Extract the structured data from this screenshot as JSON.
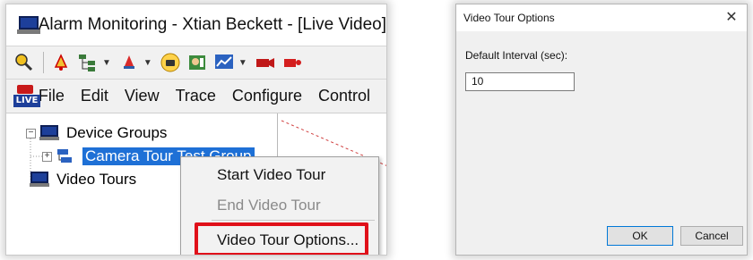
{
  "left_window": {
    "title": "Alarm Monitoring - Xtian Beckett - [Live Video]",
    "live_badge": "LIVE",
    "menu": {
      "file": "File",
      "edit": "Edit",
      "view": "View",
      "trace": "Trace",
      "configure": "Configure",
      "control": "Control"
    },
    "tree": {
      "device_groups": "Device Groups",
      "camera_tour_test_group": "Camera Tour Test Group",
      "video_tours": "Video Tours"
    },
    "context_menu": {
      "start_video_tour": "Start Video Tour",
      "end_video_tour": "End Video Tour",
      "video_tour_options": "Video Tour Options..."
    },
    "highlight_color": "#e0101a",
    "selection_color": "#1e70d6"
  },
  "right_window": {
    "title": "Video Tour Options",
    "close_glyph": "✕",
    "interval_label": "Default Interval (sec):",
    "interval_value": "10",
    "ok_label": "OK",
    "cancel_label": "Cancel"
  }
}
